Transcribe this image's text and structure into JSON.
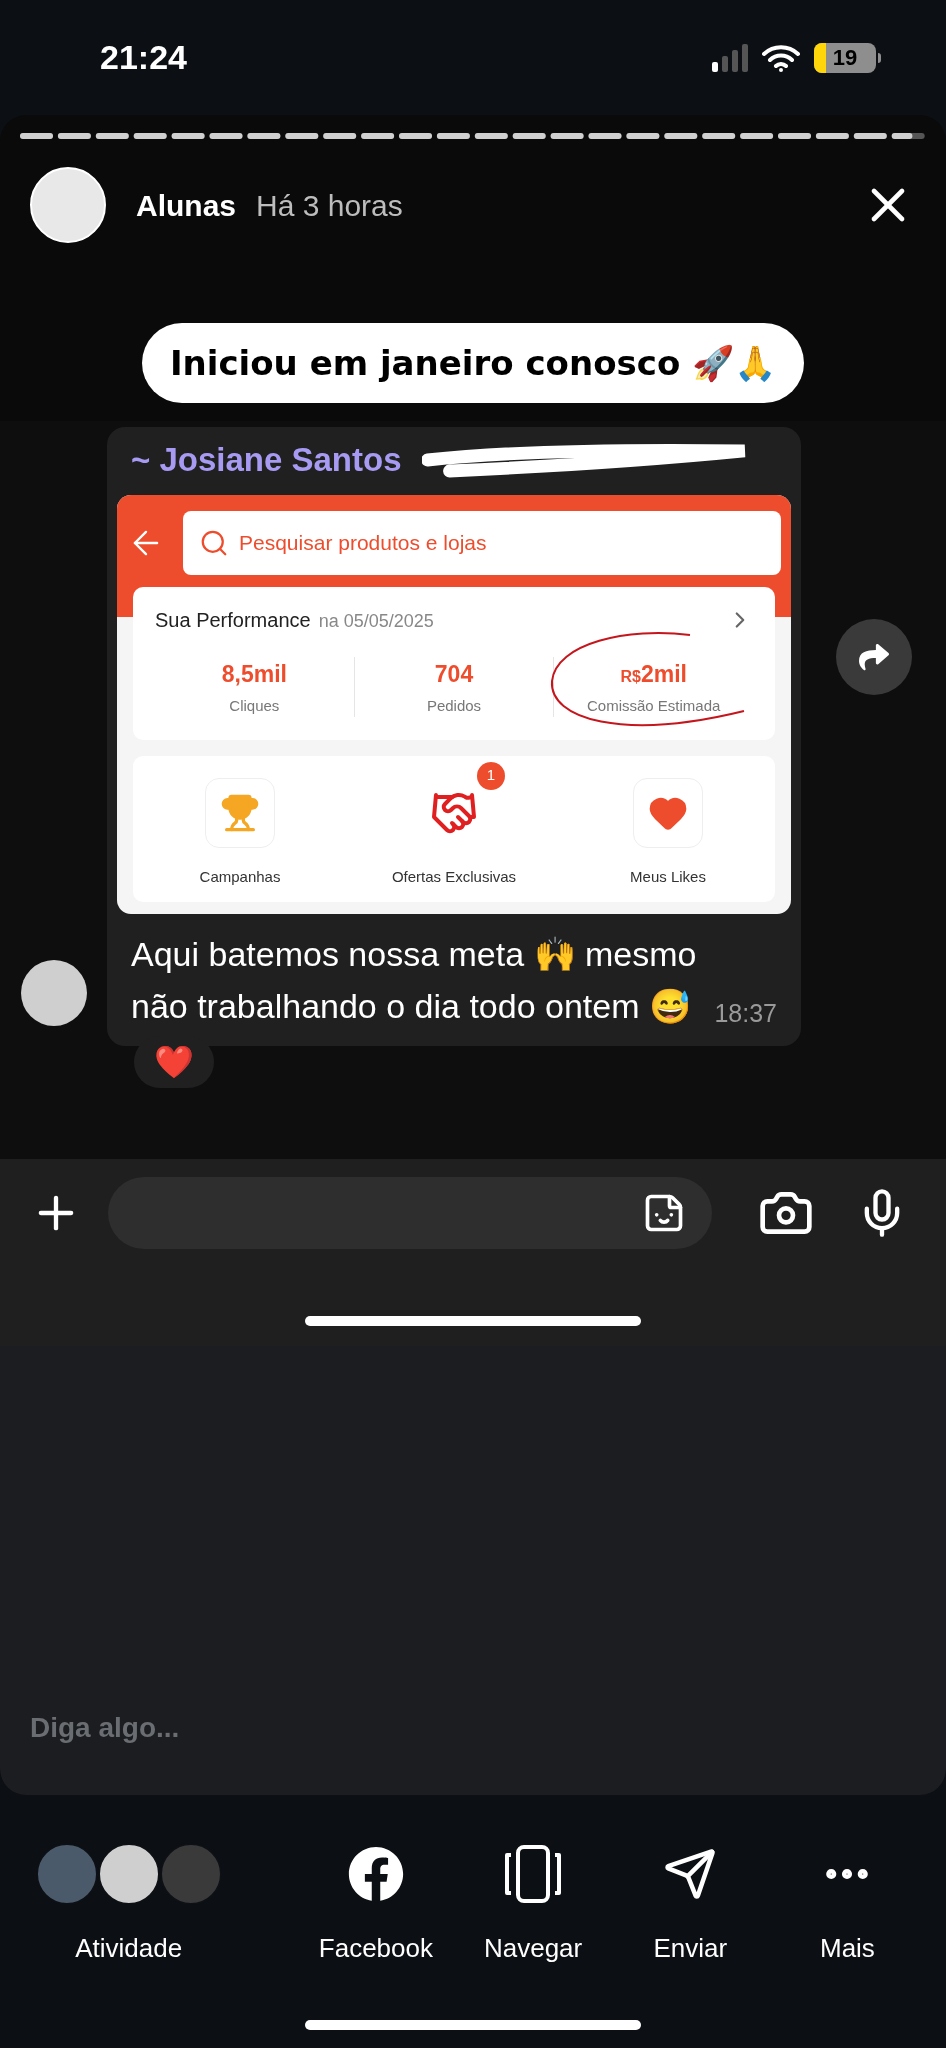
{
  "status_bar": {
    "time": "21:24",
    "battery": "19"
  },
  "story": {
    "progress": {
      "level": 0.985
    },
    "author": "Alunas",
    "time": "Há 3 horas",
    "caption": "Iniciou em janeiro conosco 🚀🙏"
  },
  "chat": {
    "sender": "~ Josiane Santos",
    "screenshot": {
      "search_placeholder": "Pesquisar produtos e lojas",
      "performance": {
        "title": "Sua Performance",
        "date": "na 05/05/2025",
        "stats": [
          {
            "value": "8,5mil",
            "label": "Cliques",
            "circled": false
          },
          {
            "value": "704",
            "label": "Pedidos",
            "circled": false
          },
          {
            "prefix": "R$",
            "value": "2mil",
            "label": "Comissão Estimada",
            "circled": true
          }
        ]
      },
      "shortcuts": [
        {
          "kind": "trophy",
          "label": "Campanhas"
        },
        {
          "kind": "handshake",
          "label": "Ofertas Exclusivas",
          "badge": "1"
        },
        {
          "kind": "heart",
          "label": "Meus Likes"
        }
      ]
    },
    "text": "Aqui batemos nossa meta 🙌 mesmo não trabalhando o dia todo ontem 😅",
    "time": "18:37",
    "reaction": "❤️"
  },
  "reply": {
    "placeholder": "Diga algo..."
  },
  "actions": [
    {
      "kind": "activity",
      "label": "Atividade"
    },
    {
      "kind": "facebook",
      "label": "Facebook"
    },
    {
      "kind": "browse",
      "label": "Navegar"
    },
    {
      "kind": "send",
      "label": "Enviar"
    },
    {
      "kind": "more",
      "label": "Mais"
    }
  ]
}
